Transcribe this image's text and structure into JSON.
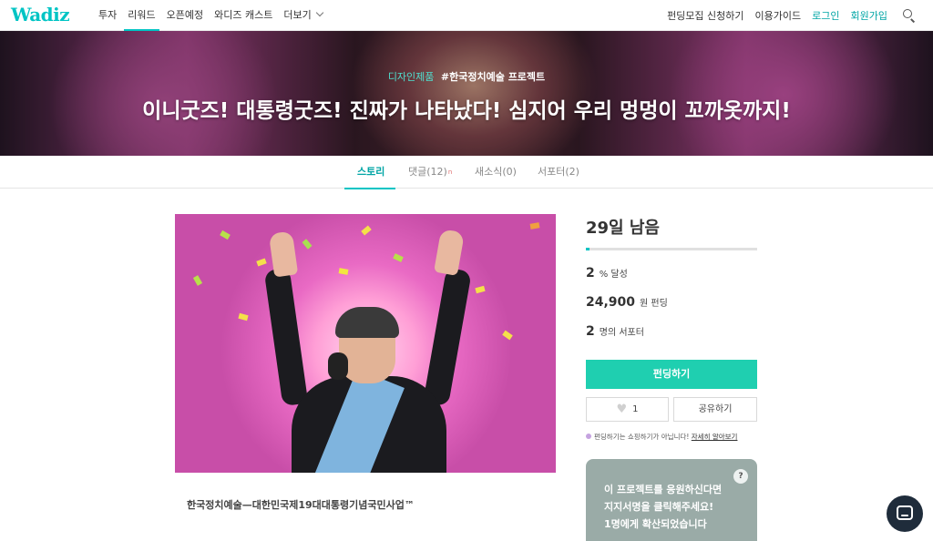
{
  "brand": {
    "logo": "Wadiz",
    "accent": "#00c4c4",
    "fund_button_color": "#1fcfb0"
  },
  "nav": {
    "left": [
      "투자",
      "리워드",
      "오픈예정",
      "와디즈 캐스트",
      "더보기"
    ],
    "right": {
      "apply": "펀딩모집 신청하기",
      "guide": "이용가이드",
      "login": "로그인",
      "signup": "회원가입"
    },
    "search_icon": "search-icon"
  },
  "banner": {
    "category": "디자인제품",
    "hashtag": "#한국정치예술 프로젝트",
    "title": "이니굿즈! 대통령굿즈! 진짜가 나타났다! 심지어 우리 멍멍이 꼬까옷까지!"
  },
  "tabs": {
    "story": "스토리",
    "comments": "댓글(12)",
    "comments_new": "n",
    "news": "새소식(0)",
    "supporters": "서포터(2)"
  },
  "main": {
    "caption": "한국정치예술—대한민국제19대대통령기념국민사업™"
  },
  "sidebar": {
    "days_left": "29일 남음",
    "progress_percent": 2,
    "achieved": {
      "value": "2",
      "unit": "% 달성"
    },
    "funded": {
      "value": "24,900",
      "unit": "원 펀딩"
    },
    "supporters": {
      "value": "2",
      "unit": "명의 서포터"
    },
    "fund_button": "펀딩하기",
    "like_count": "1",
    "share_button": "공유하기",
    "notice_text": "펀딩하기는 쇼핑하기가 아닙니다!",
    "notice_link": "자세히 알아보기",
    "support_lines": [
      "이 프로젝트를 응원하신다면",
      "지지서명을 클릭해주세요!",
      "1명에게 확산되었습니다"
    ],
    "help_label": "?"
  }
}
